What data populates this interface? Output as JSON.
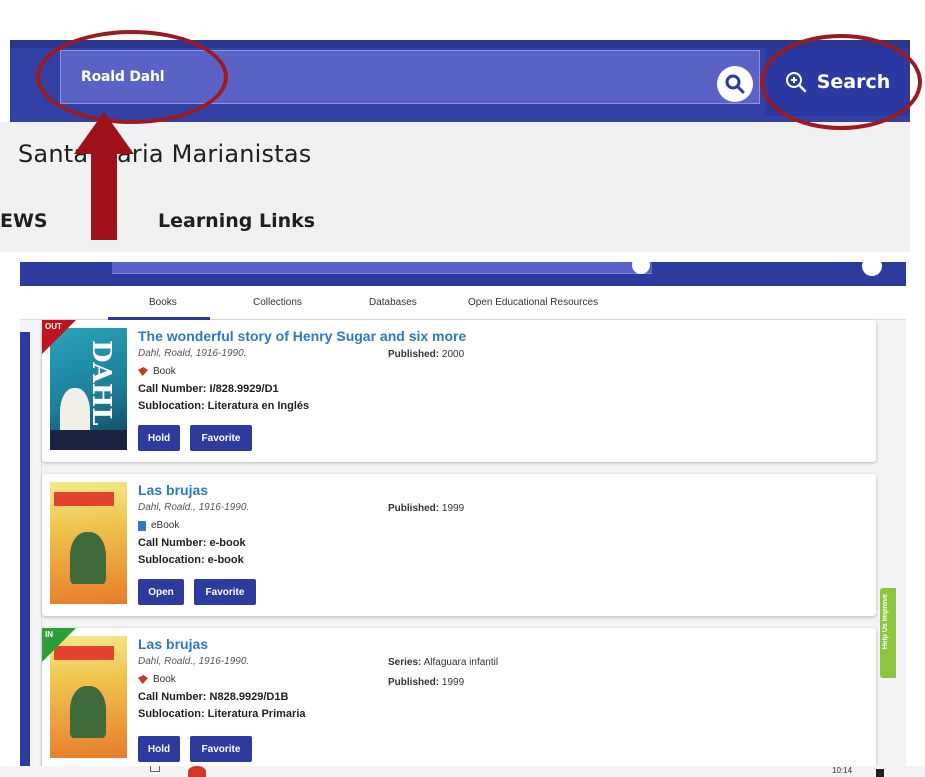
{
  "header": {
    "search_value": "Roald Dahl",
    "search_button_label": "Search",
    "library_name": "Santa Maria Marianistas",
    "menu": [
      "EWS",
      "Learning Links"
    ]
  },
  "tabs": [
    "Books",
    "Collections",
    "Databases",
    "Open Educational Resources"
  ],
  "active_tab": "Books",
  "results": [
    {
      "status": "OUT",
      "title": "The wonderful story of Henry Sugar and six more",
      "author": "Dahl, Roald, 1916-1990.",
      "format": "Book",
      "call_number_label": "Call Number:",
      "call_number": "I/828.9929/D1",
      "sublocation_label": "Sublocation:",
      "sublocation": "Literatura en Inglés",
      "published_label": "Published:",
      "published": "2000",
      "buttons": [
        "Hold",
        "Favorite"
      ]
    },
    {
      "status": "",
      "title": "Las brujas",
      "author": "Dahl, Roald., 1916-1990.",
      "format": "eBook",
      "call_number_label": "Call Number:",
      "call_number": "e-book",
      "sublocation_label": "Sublocation:",
      "sublocation": "e-book",
      "published_label": "Published:",
      "published": "1999",
      "buttons": [
        "Open",
        "Favorite"
      ]
    },
    {
      "status": "IN",
      "title": "Las brujas",
      "author": "Dahl, Roald., 1916-1990.",
      "format": "Book",
      "call_number_label": "Call Number:",
      "call_number": "N828.9929/D1B",
      "sublocation_label": "Sublocation:",
      "sublocation": "Literatura Primaria",
      "series_label": "Series:",
      "series": "Alfaguara infantil",
      "published_label": "Published:",
      "published": "1999",
      "buttons": [
        "Hold",
        "Favorite"
      ]
    }
  ],
  "side_widget": "Help Us Improve",
  "taskbar": {
    "clock": "10:14"
  },
  "colors": {
    "nav_blue": "#3341a4",
    "search_field": "#5a62c6",
    "button_blue": "#2d3a9e",
    "title_link": "#2f78c4",
    "annotation_red": "#9b1b21",
    "status_out": "#c1121f",
    "status_in": "#2e9e3b",
    "help_green": "#8cc63e"
  }
}
